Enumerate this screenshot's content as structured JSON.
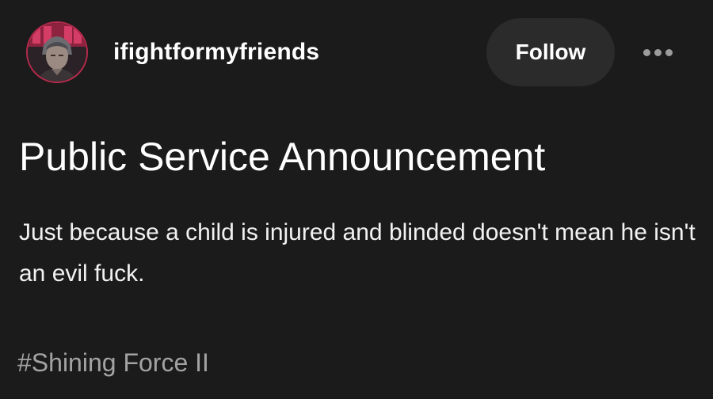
{
  "post": {
    "author": {
      "username": "ifightformyfriends",
      "avatar_icon": "user-avatar"
    },
    "follow_label": "Follow",
    "more_icon": "more-horizontal-icon",
    "title": "Public Service Announcement",
    "body": "Just because a child is injured and blinded doesn't mean he isn't an evil fuck.",
    "tags": [
      "#Shining Force II"
    ]
  },
  "colors": {
    "background": "#1b1b1b",
    "button_bg": "#2b2b2b",
    "tag_text": "#a3a3a3",
    "avatar_ring": "#b62a4c"
  }
}
